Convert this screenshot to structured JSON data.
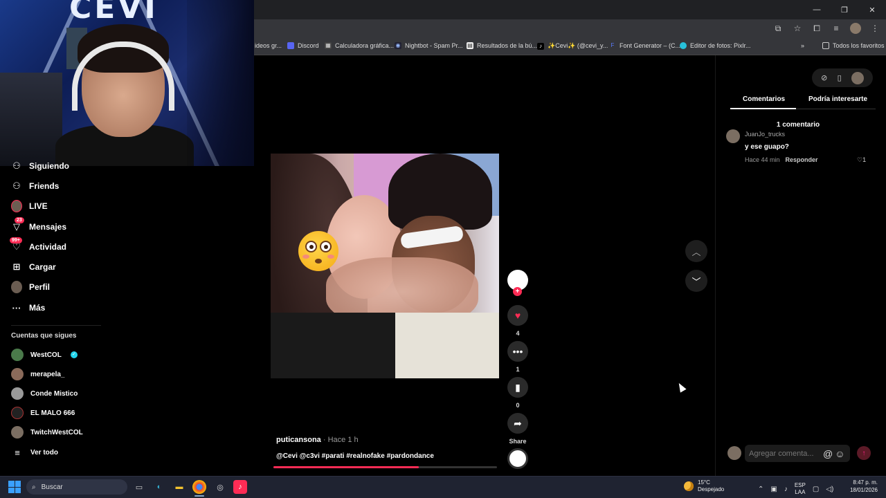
{
  "browser": {
    "bookmarks": [
      {
        "label": "ideos gr...",
        "icon": "folder-icon"
      },
      {
        "label": "Discord",
        "icon": "discord-icon"
      },
      {
        "label": "Calculadora gráfica...",
        "icon": "calculator-icon"
      },
      {
        "label": "Nightbot - Spam Pr...",
        "icon": "nightbot-icon"
      },
      {
        "label": "Resultados de la bú...",
        "icon": "page-icon"
      },
      {
        "label": "✨Cevi✨ (@cevi_y...",
        "icon": "tiktok-icon"
      },
      {
        "label": "Font Generator – (C...",
        "icon": "font-icon"
      },
      {
        "label": "Editor de fotos: Pixlr...",
        "icon": "pixlr-icon"
      }
    ],
    "all_bookmarks": "Todos los favoritos",
    "more": "»"
  },
  "webcam": {
    "logo_text": "CEVI"
  },
  "sidebar": {
    "items": [
      {
        "label": "Siguiendo",
        "icon": "following-icon"
      },
      {
        "label": "Friends",
        "icon": "friends-icon"
      },
      {
        "label": "LIVE",
        "icon": "live-icon"
      },
      {
        "label": "Mensajes",
        "icon": "messages-icon",
        "badge": "23"
      },
      {
        "label": "Actividad",
        "icon": "activity-icon",
        "badge": "99+"
      },
      {
        "label": "Cargar",
        "icon": "upload-icon"
      },
      {
        "label": "Perfil",
        "icon": "profile-icon"
      },
      {
        "label": "Más",
        "icon": "more-icon"
      }
    ],
    "following_title": "Cuentas que sigues",
    "following": [
      {
        "name": "WestCOL",
        "verified": true
      },
      {
        "name": "merapela_"
      },
      {
        "name": "Conde Mistico"
      },
      {
        "name": "EL MALO 666"
      },
      {
        "name": "TwitchWestCOL"
      }
    ],
    "see_all": "Ver todo"
  },
  "video": {
    "author": "puticansona",
    "time": "· Hace 1 h",
    "caption": "@Cevi @c3vi #parati  #realnofake #pardondance",
    "progress_fraction": 0.65
  },
  "actions": {
    "likes": "4",
    "comments": "1",
    "saves": "0",
    "share_label": "Share",
    "like_color": "#fe2c55"
  },
  "comments_panel": {
    "tabs": [
      "Comentarios",
      "Podría interesarte"
    ],
    "count_label": "1 comentario",
    "comments": [
      {
        "user": "JuanJo_trucks",
        "text": "y ese guapo?",
        "time": "Hace 44 min",
        "reply": "Responder",
        "likes": "♡1"
      }
    ],
    "input_placeholder": "Agregar comenta...",
    "mention_icon": "@",
    "emoji_icon": "☺",
    "send_icon": "↑"
  },
  "taskbar": {
    "search_label": "Buscar",
    "weather_temp": "15°C",
    "weather_desc": "Despejado",
    "lang_top": "ESP",
    "lang_bottom": "LAA",
    "time": "8:47 p. m.",
    "date": "18/01/2026"
  },
  "colors": {
    "accent": "#fe2c55",
    "verified": "#20d5ec",
    "taskbar": "#1f2331"
  }
}
